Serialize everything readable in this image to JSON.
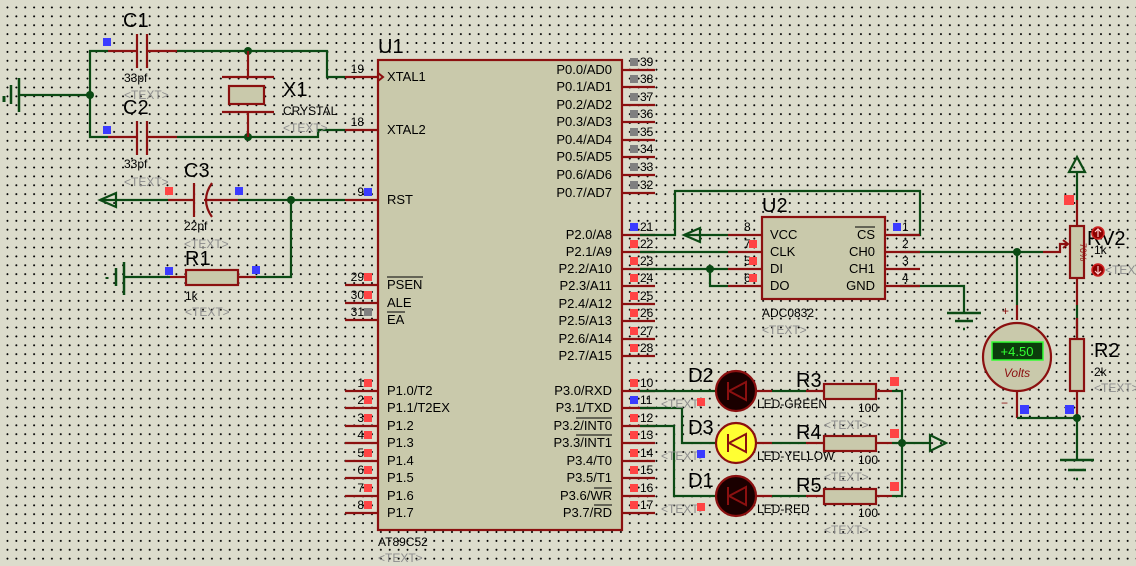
{
  "schematic": {
    "u1": {
      "ref": "U1",
      "part": "AT89C52",
      "text": "<TEXT>",
      "left_pins": [
        {
          "num": "19",
          "name": "XTAL1",
          "state": "none"
        },
        {
          "num": "18",
          "name": "XTAL2",
          "state": "none"
        },
        {
          "num": "9",
          "name": "RST",
          "state": "low"
        },
        {
          "num": "29",
          "name": "PSEN",
          "state": "high"
        },
        {
          "num": "30",
          "name": "ALE",
          "state": "high"
        },
        {
          "num": "31",
          "name": "EA",
          "state": "float"
        },
        {
          "num": "1",
          "name": "P1.0/T2",
          "state": "high"
        },
        {
          "num": "2",
          "name": "P1.1/T2EX",
          "state": "high"
        },
        {
          "num": "3",
          "name": "P1.2",
          "state": "high"
        },
        {
          "num": "4",
          "name": "P1.3",
          "state": "high"
        },
        {
          "num": "5",
          "name": "P1.4",
          "state": "high"
        },
        {
          "num": "6",
          "name": "P1.5",
          "state": "high"
        },
        {
          "num": "7",
          "name": "P1.6",
          "state": "high"
        },
        {
          "num": "8",
          "name": "P1.7",
          "state": "high"
        }
      ],
      "right_pins": [
        {
          "num": "39",
          "name": "P0.0/AD0",
          "state": "float"
        },
        {
          "num": "38",
          "name": "P0.1/AD1",
          "state": "float"
        },
        {
          "num": "37",
          "name": "P0.2/AD2",
          "state": "float"
        },
        {
          "num": "36",
          "name": "P0.3/AD3",
          "state": "float"
        },
        {
          "num": "35",
          "name": "P0.4/AD4",
          "state": "float"
        },
        {
          "num": "34",
          "name": "P0.5/AD5",
          "state": "float"
        },
        {
          "num": "33",
          "name": "P0.6/AD6",
          "state": "float"
        },
        {
          "num": "32",
          "name": "P0.7/AD7",
          "state": "float"
        },
        {
          "num": "21",
          "name": "P2.0/A8",
          "state": "low"
        },
        {
          "num": "22",
          "name": "P2.1/A9",
          "state": "high"
        },
        {
          "num": "23",
          "name": "P2.2/A10",
          "state": "high"
        },
        {
          "num": "24",
          "name": "P2.3/A11",
          "state": "high"
        },
        {
          "num": "25",
          "name": "P2.4/A12",
          "state": "high"
        },
        {
          "num": "26",
          "name": "P2.5/A13",
          "state": "high"
        },
        {
          "num": "27",
          "name": "P2.6/A14",
          "state": "high"
        },
        {
          "num": "28",
          "name": "P2.7/A15",
          "state": "high"
        },
        {
          "num": "10",
          "name": "P3.0/RXD",
          "state": "high"
        },
        {
          "num": "11",
          "name": "P3.1/TXD",
          "state": "low"
        },
        {
          "num": "12",
          "name": "P3.2/INT0",
          "state": "high"
        },
        {
          "num": "13",
          "name": "P3.3/INT1",
          "state": "high"
        },
        {
          "num": "14",
          "name": "P3.4/T0",
          "state": "high"
        },
        {
          "num": "15",
          "name": "P3.5/T1",
          "state": "high"
        },
        {
          "num": "16",
          "name": "P3.6/WR",
          "state": "high"
        },
        {
          "num": "17",
          "name": "P3.7/RD",
          "state": "high"
        }
      ]
    },
    "u2": {
      "ref": "U2",
      "part": "ADC0832",
      "text": "<TEXT>",
      "left_pins": [
        {
          "num": "8",
          "name": "VCC"
        },
        {
          "num": "7",
          "name": "CLK"
        },
        {
          "num": "5",
          "name": "DI"
        },
        {
          "num": "6",
          "name": "DO"
        }
      ],
      "right_pins": [
        {
          "num": "1",
          "name": "CS"
        },
        {
          "num": "2",
          "name": "CH0"
        },
        {
          "num": "3",
          "name": "CH1"
        },
        {
          "num": "4",
          "name": "GND"
        }
      ]
    },
    "c1": {
      "ref": "C1",
      "value": "33pf",
      "text": "<TEXT>"
    },
    "c2": {
      "ref": "C2",
      "value": "33pf",
      "text": "<TEXT>"
    },
    "c3": {
      "ref": "C3",
      "value": "22pf",
      "text": "<TEXT>"
    },
    "x1": {
      "ref": "X1",
      "value": "CRYSTAL",
      "text": "<TEXT>"
    },
    "r1": {
      "ref": "R1",
      "value": "1k",
      "text": "<TEXT>"
    },
    "r2": {
      "ref": "R2",
      "value": "2k",
      "text": "<TEXT>"
    },
    "rv2": {
      "ref": "RV2",
      "value": "1k",
      "text": "<TEXT>",
      "wiper_percent": "70%"
    },
    "r3": {
      "ref": "R3",
      "value": "100",
      "text": "<TEXT>"
    },
    "r4": {
      "ref": "R4",
      "value": "100",
      "text": "<TEXT>"
    },
    "r5": {
      "ref": "R5",
      "value": "100",
      "text": "<TEXT>"
    },
    "d2": {
      "ref": "D2",
      "value": "LED-GREEN",
      "text": "<TEXT>",
      "lit": false
    },
    "d3": {
      "ref": "D3",
      "value": "LED-YELLOW",
      "text": "<TEXT>",
      "lit": true
    },
    "d1": {
      "ref": "D1",
      "value": "LED-RED",
      "text": "<TEXT>",
      "lit": false
    },
    "voltmeter": {
      "reading": "+4.50",
      "unit": "Volts",
      "plus": "+",
      "minus": "−"
    },
    "colors": {
      "background": "#dcdccc",
      "wire": "#0b4a14",
      "lead": "#8b1010",
      "body": "#c9c9ab",
      "logic_high": "#ff4444",
      "logic_low": "#3b3bff",
      "float": "#808080",
      "led_yellow_on": "#ffff33",
      "led_off": "#1a0000",
      "meter_display": "#0b3d0b",
      "meter_text": "#33ff33"
    }
  }
}
